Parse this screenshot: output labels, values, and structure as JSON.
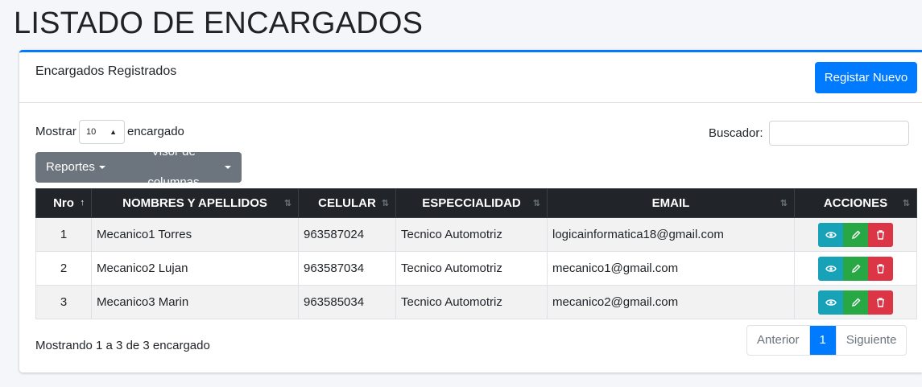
{
  "page": {
    "title": "LISTADO DE ENCARGADOS"
  },
  "card": {
    "title": "Encargados Registrados",
    "new_button": "Registar Nuevo"
  },
  "length": {
    "prefix": "Mostrar",
    "value": "10",
    "suffix": "encargado"
  },
  "search": {
    "label": "Buscador:",
    "value": ""
  },
  "toolbar": {
    "reports": "Reportes",
    "columns": "Visor de columnas"
  },
  "table": {
    "headers": [
      "Nro",
      "NOMBRES Y APELLIDOS",
      "CELULAR",
      "ESPECCIALIDAD",
      "EMAIL",
      "ACCIONES"
    ],
    "rows": [
      {
        "nro": "1",
        "name": "Mecanico1 Torres",
        "phone": "963587024",
        "specialty": "Tecnico Automotriz",
        "email": "logicainformatica18@gmail.com"
      },
      {
        "nro": "2",
        "name": "Mecanico2 Lujan",
        "phone": "963587034",
        "specialty": "Tecnico Automotriz",
        "email": "mecanico1@gmail.com"
      },
      {
        "nro": "3",
        "name": "Mecanico3 Marin",
        "phone": "963585034",
        "specialty": "Tecnico Automotriz",
        "email": "mecanico2@gmail.com"
      }
    ]
  },
  "footer": {
    "info": "Mostrando 1 a 3 de 3 encargado",
    "prev": "Anterior",
    "current_page": "1",
    "next": "Siguiente"
  },
  "icons": {
    "view": "eye-icon",
    "edit": "pencil-icon",
    "delete": "trash-icon",
    "sort": "sort-arrows-icon"
  },
  "colors": {
    "primary": "#007bff",
    "info": "#17a2b8",
    "success": "#28a745",
    "danger": "#dc3545",
    "secondary": "#6c757d",
    "dark": "#212529"
  }
}
